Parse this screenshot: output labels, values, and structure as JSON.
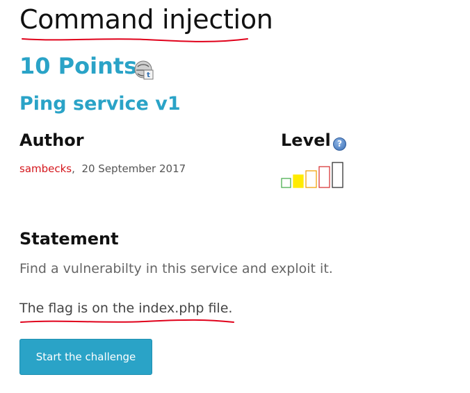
{
  "challenge": {
    "title": "Command injection",
    "points": "10 Points",
    "name": "Ping service v1"
  },
  "author": {
    "heading": "Author",
    "name": "sambecks",
    "separator": ",",
    "date": "20 September 2017"
  },
  "level": {
    "heading": "Level",
    "help_icon": "question-icon",
    "difficulty": 2,
    "max": 5,
    "colors": [
      "#4caf50",
      "#ffeb00",
      "#f0a30a",
      "#d9383a",
      "#333333"
    ]
  },
  "statement": {
    "heading": "Statement",
    "text": "Find a vulnerabilty in this service and exploit it.",
    "flag_text": "The flag is on the index.php file."
  },
  "actions": {
    "start_label": "Start the challenge"
  },
  "colors": {
    "accent": "#2aa3c7",
    "author": "#d4161c",
    "scribble": "#e0001a"
  }
}
